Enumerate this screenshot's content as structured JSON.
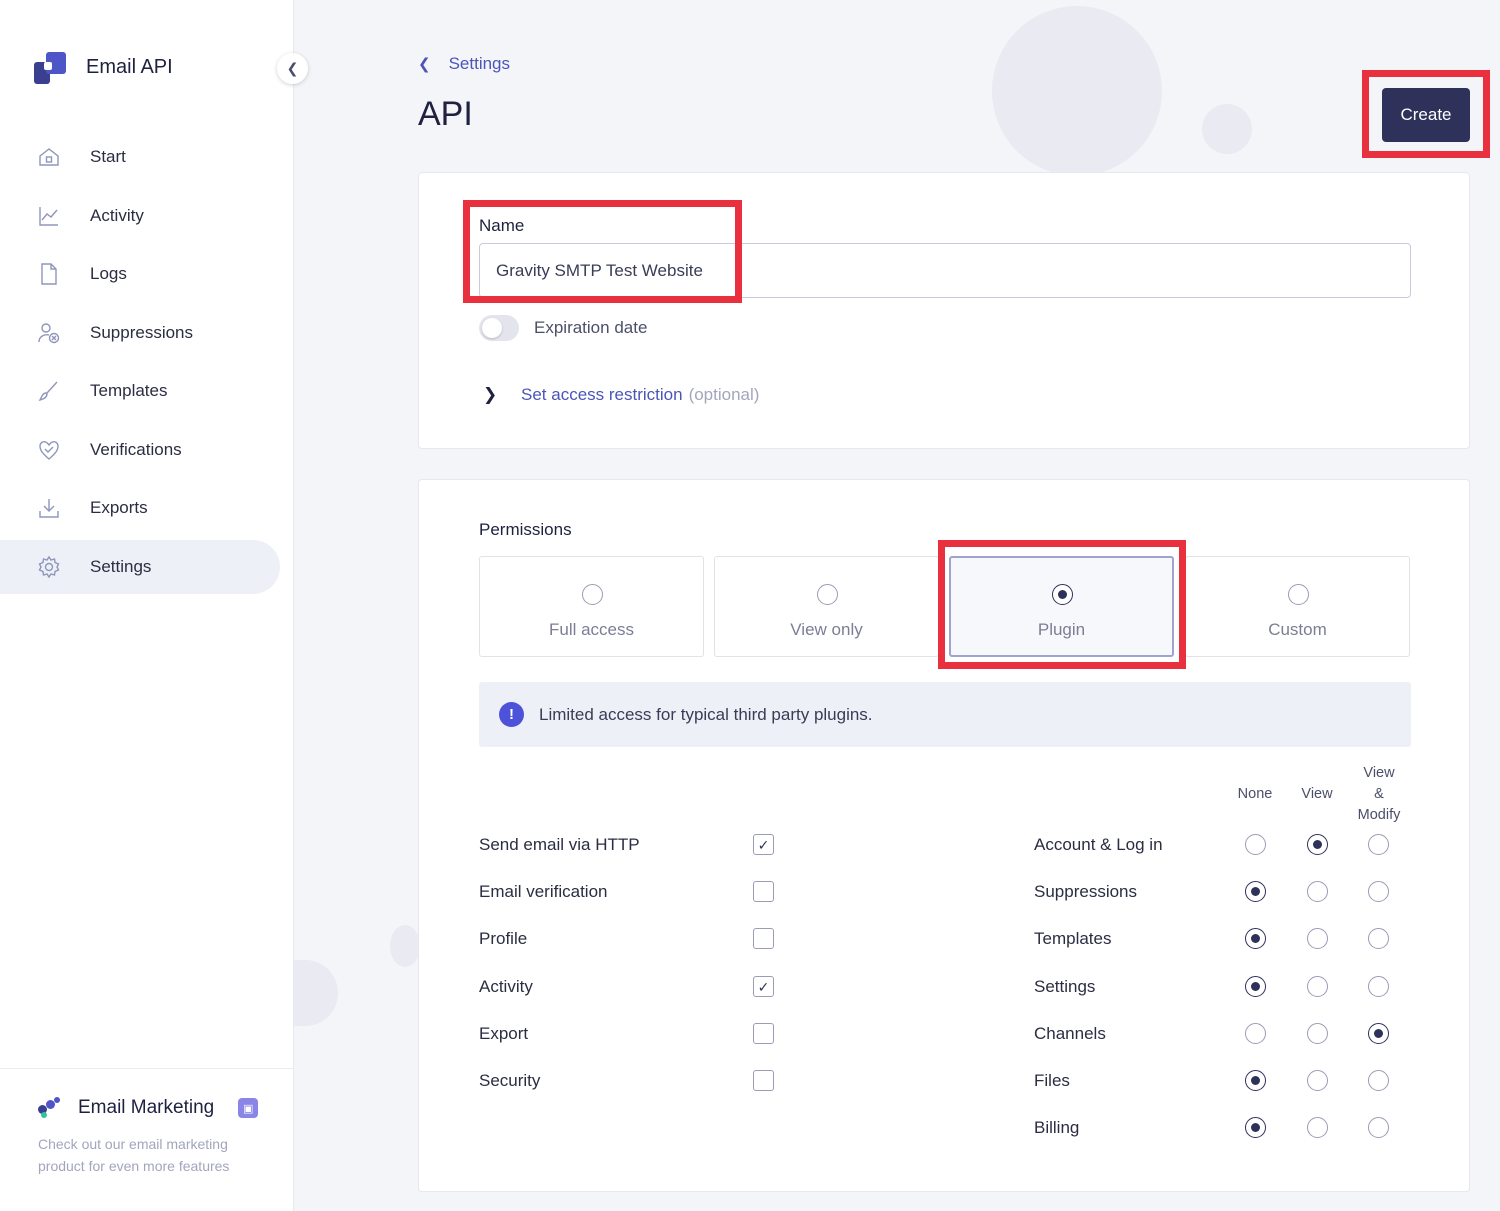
{
  "app": {
    "name": "Email API",
    "collapse_icon": "chevron-left-icon"
  },
  "sidebar": {
    "items": [
      {
        "label": "Start",
        "icon": "home-icon",
        "active": false
      },
      {
        "label": "Activity",
        "icon": "chart-icon",
        "active": false
      },
      {
        "label": "Logs",
        "icon": "file-icon",
        "active": false
      },
      {
        "label": "Suppressions",
        "icon": "user-block-icon",
        "active": false
      },
      {
        "label": "Templates",
        "icon": "brush-icon",
        "active": false
      },
      {
        "label": "Verifications",
        "icon": "heart-check-icon",
        "active": false
      },
      {
        "label": "Exports",
        "icon": "download-icon",
        "active": false
      },
      {
        "label": "Settings",
        "icon": "gear-icon",
        "active": true
      }
    ],
    "promo": {
      "title": "Email Marketing",
      "text": "Check out our email marketing product for even more features",
      "badge_icon": "lock-icon"
    }
  },
  "header": {
    "back_label": "Settings",
    "title": "API",
    "create_label": "Create"
  },
  "form": {
    "name_label": "Name",
    "name_value": "Gravity SMTP Test Website",
    "expiration_label": "Expiration date",
    "expiration_enabled": false,
    "restriction_label": "Set access restriction",
    "restriction_optional": "(optional)"
  },
  "permissions": {
    "title": "Permissions",
    "options": [
      {
        "label": "Full access",
        "selected": false
      },
      {
        "label": "View only",
        "selected": false
      },
      {
        "label": "Plugin",
        "selected": true
      },
      {
        "label": "Custom",
        "selected": false
      }
    ],
    "info_text": "Limited access for typical third party plugins.",
    "toggles": [
      {
        "label": "Send email via HTTP",
        "checked": true
      },
      {
        "label": "Email verification",
        "checked": false
      },
      {
        "label": "Profile",
        "checked": false
      },
      {
        "label": "Activity",
        "checked": true
      },
      {
        "label": "Export",
        "checked": false
      },
      {
        "label": "Security",
        "checked": false
      }
    ],
    "columns": [
      "None",
      "View",
      "View\n&\nModify"
    ],
    "scoped": [
      {
        "label": "Account & Log in",
        "level": 1
      },
      {
        "label": "Suppressions",
        "level": 0
      },
      {
        "label": "Templates",
        "level": 0
      },
      {
        "label": "Settings",
        "level": 0
      },
      {
        "label": "Channels",
        "level": 2
      },
      {
        "label": "Files",
        "level": 0
      },
      {
        "label": "Billing",
        "level": 0
      }
    ]
  },
  "colors": {
    "accent": "#4b55b8",
    "button_dark": "#2e3159",
    "highlight": "#e8303f",
    "info_bg": "#eef0f8"
  }
}
